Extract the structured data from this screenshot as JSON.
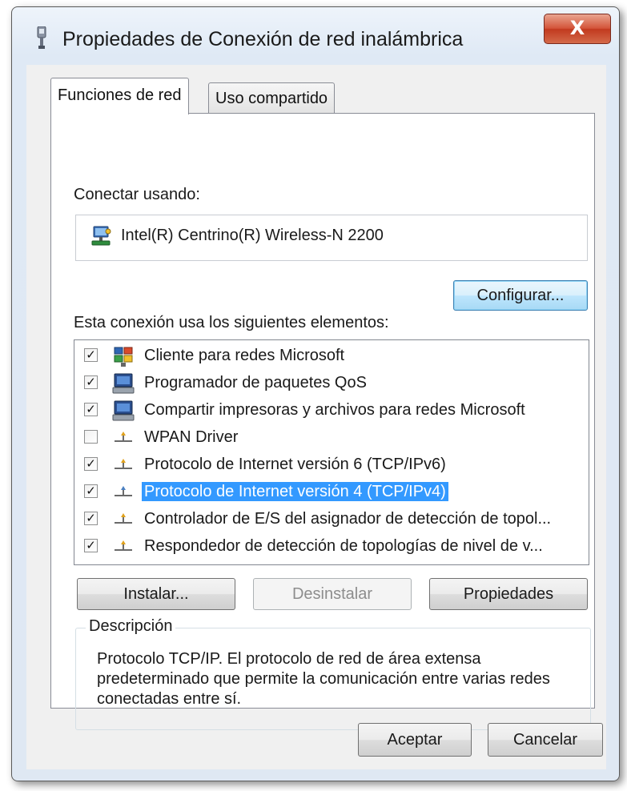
{
  "window": {
    "title": "Propiedades de Conexión de red inalámbrica",
    "close_label": "X"
  },
  "tabs": [
    {
      "label": "Funciones de red",
      "active": true
    },
    {
      "label": "Uso compartido",
      "active": false
    }
  ],
  "connect_using": {
    "label": "Conectar usando:",
    "adapter_name": "Intel(R) Centrino(R) Wireless-N 2200",
    "adapter_icon": "network-adapter-icon",
    "configure_label": "Configurar..."
  },
  "elements": {
    "label": "Esta conexión usa los siguientes elementos:",
    "items": [
      {
        "label": "Cliente para redes Microsoft",
        "checked": true,
        "icon": "client-network-icon",
        "selected": false
      },
      {
        "label": "Programador de paquetes QoS",
        "checked": true,
        "icon": "service-computer-icon",
        "selected": false
      },
      {
        "label": "Compartir impresoras y archivos para redes Microsoft",
        "checked": true,
        "icon": "service-computer-icon",
        "selected": false
      },
      {
        "label": "WPAN Driver",
        "checked": false,
        "icon": "protocol-icon",
        "selected": false
      },
      {
        "label": "Protocolo de Internet versión 6 (TCP/IPv6)",
        "checked": true,
        "icon": "protocol-icon",
        "selected": false
      },
      {
        "label": "Protocolo de Internet versión 4 (TCP/IPv4)",
        "checked": true,
        "icon": "protocol-icon",
        "selected": true
      },
      {
        "label": "Controlador de E/S del asignador de detección de topol...",
        "checked": true,
        "icon": "protocol-icon",
        "selected": false
      },
      {
        "label": "Respondedor de detección de topologías de nivel de v...",
        "checked": true,
        "icon": "protocol-icon",
        "selected": false
      }
    ]
  },
  "actions": {
    "install_label": "Instalar...",
    "uninstall_label": "Desinstalar",
    "properties_label": "Propiedades"
  },
  "description": {
    "legend": "Descripción",
    "text": "Protocolo TCP/IP. El protocolo de red de área extensa predeterminado que permite la comunicación entre varias redes conectadas entre sí."
  },
  "footer": {
    "ok_label": "Aceptar",
    "cancel_label": "Cancelar"
  },
  "colors": {
    "selection": "#3399ff",
    "close_button": "#c8432a"
  }
}
